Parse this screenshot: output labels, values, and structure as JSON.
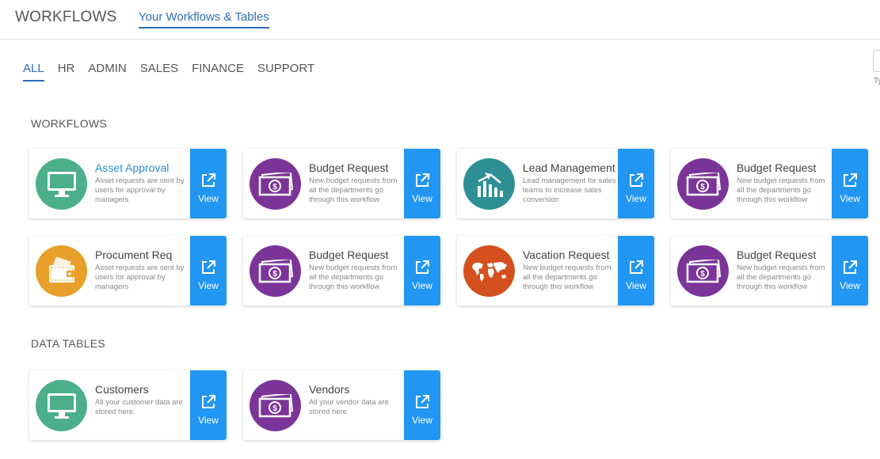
{
  "header": {
    "title": "WORKFLOWS",
    "tab": "Your Workflows & Tables"
  },
  "filters": [
    "ALL",
    "HR",
    "ADMIN",
    "SALES",
    "FINANCE",
    "SUPPORT"
  ],
  "edge_text": "Ty",
  "sections": {
    "workflows": "WORKFLOWS",
    "data_tables": "DATA TABLES"
  },
  "view_label": "View",
  "colors": {
    "green": "#4caf89",
    "purple": "#7b3599",
    "teal": "#2e8f96",
    "orange": "#e8a02a",
    "red": "#d4511f",
    "blue": "#2196f3"
  },
  "workflows": [
    {
      "title": "Asset Approval",
      "desc": "Asset requests are sent by users for approval by managers",
      "icon": "monitor-icon"
    },
    {
      "title": "Budget Request",
      "desc": "New budget requests from all the departments go through this workflow",
      "icon": "money-icon"
    },
    {
      "title": "Lead Management",
      "desc": "Lead management for sales teams to increase sales conversion",
      "icon": "chart-icon"
    },
    {
      "title": "Budget Request",
      "desc": "New budget requests from all the departments go through this workflow",
      "icon": "money-icon"
    },
    {
      "title": "Procument Req",
      "desc": "Asset requests are sent by users for approval by managers",
      "icon": "wallet-icon"
    },
    {
      "title": "Budget Request",
      "desc": "New budget requests from all the departments go through this workflow",
      "icon": "money-icon"
    },
    {
      "title": "Vacation Request",
      "desc": "New budget requests from all the departments go through this workflow",
      "icon": "world-map-icon"
    },
    {
      "title": "Budget Request",
      "desc": "New budget requests from all the departments go through this workflow",
      "icon": "money-icon"
    }
  ],
  "data_tables": [
    {
      "title": "Customers",
      "desc": "All your customer data are stored here.",
      "icon": "monitor-icon"
    },
    {
      "title": "Vendors",
      "desc": "All your vendor data are stored here.",
      "icon": "money-icon"
    }
  ]
}
